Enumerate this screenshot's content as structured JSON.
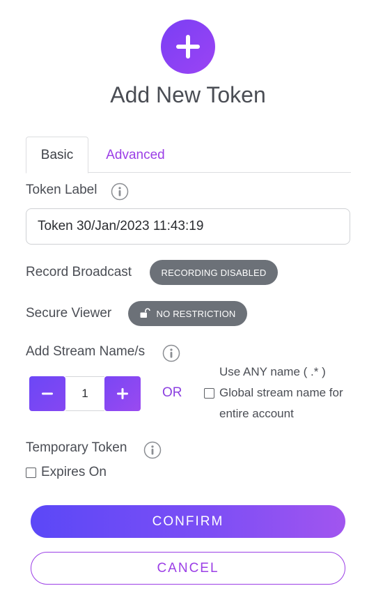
{
  "header": {
    "title": "Add New Token",
    "icon": "plus-icon"
  },
  "tabs": [
    {
      "label": "Basic",
      "active": true
    },
    {
      "label": "Advanced",
      "active": false
    }
  ],
  "token_label": {
    "label": "Token Label",
    "value": "Token 30/Jan/2023 11:43:19",
    "icon": "info-icon"
  },
  "record_broadcast": {
    "label": "Record Broadcast",
    "status": "RECORDING DISABLED"
  },
  "secure_viewer": {
    "label": "Secure Viewer",
    "status": "NO RESTRICTION",
    "icon": "unlock-icon"
  },
  "stream_names": {
    "label": "Add Stream Name/s",
    "count": "1",
    "or_text": "OR",
    "any_name": "Use ANY name ( .* )",
    "global_line": "Global stream name for",
    "entire_line": "entire account"
  },
  "temporary_token": {
    "label": "Temporary Token",
    "expires_label": "Expires On"
  },
  "actions": {
    "confirm": "CONFIRM",
    "cancel": "CANCEL"
  },
  "colors": {
    "accent": "#9b3ee6",
    "primary_gradient_start": "#5b48f7",
    "pill_gray": "#6c7178"
  }
}
